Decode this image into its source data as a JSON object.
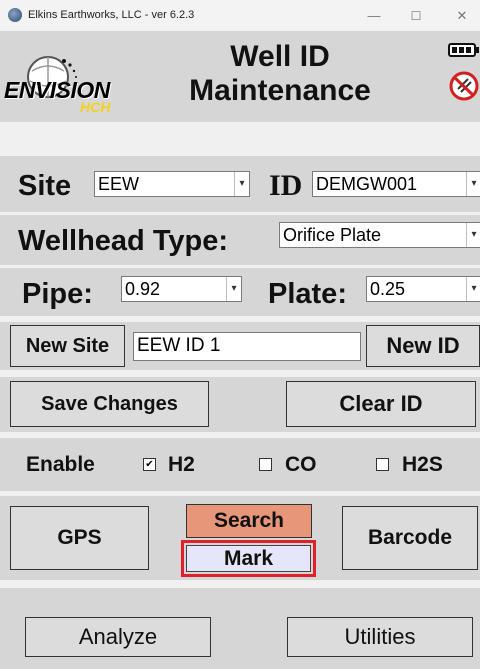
{
  "window": {
    "title": "Elkins Earthworks, LLC - ver 6.2.3",
    "minimize": "—",
    "maximize": "☐",
    "close": "✕"
  },
  "header": {
    "logo_text": "ENVISION",
    "logo_sub": "HCH",
    "title_line1": "Well ID",
    "title_line2": "Maintenance"
  },
  "form": {
    "site_label": "Site",
    "site_value": "EEW",
    "id_label": "ID",
    "id_value": "DEMGW001",
    "wellhead_label": "Wellhead Type:",
    "wellhead_value": "Orifice Plate",
    "pipe_label": "Pipe:",
    "pipe_value": "0.92",
    "plate_label": "Plate:",
    "plate_value": "0.25"
  },
  "new_row": {
    "new_site_label": "New Site",
    "new_site_input": "EEW ID 1",
    "new_id_label": "New ID"
  },
  "actions": {
    "save_label": "Save Changes",
    "clear_label": "Clear ID"
  },
  "gases": {
    "enable_label": "Enable",
    "h2_label": "H2",
    "h2_checked": true,
    "co_label": "CO",
    "co_checked": false,
    "h2s_label": "H2S",
    "h2s_checked": false
  },
  "location": {
    "gps_label": "GPS",
    "search_label": "Search",
    "mark_label": "Mark",
    "barcode_label": "Barcode"
  },
  "footer": {
    "analyze_label": "Analyze",
    "utilities_label": "Utilities"
  },
  "colors": {
    "search_bg": "#e8967a",
    "mark_bg": "#e6e6fa",
    "mark_highlight": "#e0202a",
    "band_bg": "#d6d6d6"
  }
}
